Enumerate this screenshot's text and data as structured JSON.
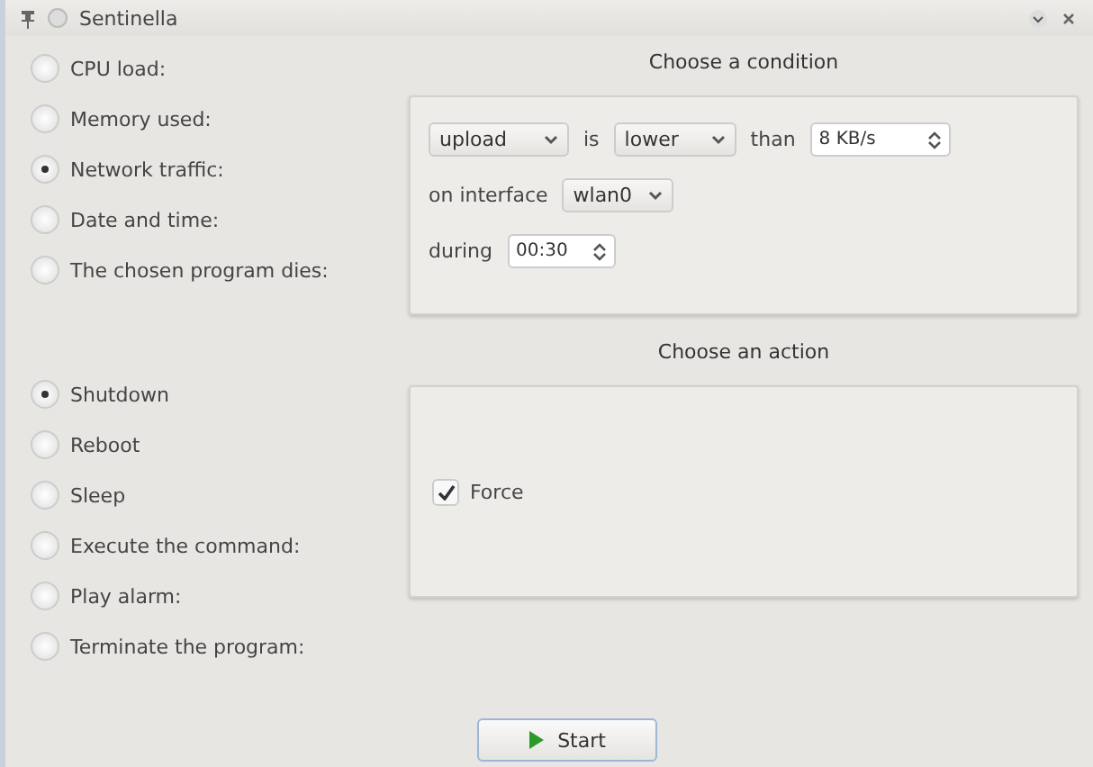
{
  "window": {
    "title": "Sentinella"
  },
  "conditions": [
    {
      "label": "CPU load:",
      "selected": false
    },
    {
      "label": "Memory used:",
      "selected": false
    },
    {
      "label": "Network traffic:",
      "selected": true
    },
    {
      "label": "Date and time:",
      "selected": false
    },
    {
      "label": "The chosen program dies:",
      "selected": false
    }
  ],
  "condition_panel": {
    "title": "Choose a condition",
    "direction": "upload",
    "is_label": "is",
    "comparison": "lower",
    "than_label": "than",
    "threshold": "8 KB/s",
    "interface_label": "on interface",
    "interface": "wlan0",
    "during_label": "during",
    "duration": "00:30"
  },
  "actions": [
    {
      "label": "Shutdown",
      "selected": true
    },
    {
      "label": "Reboot",
      "selected": false
    },
    {
      "label": "Sleep",
      "selected": false
    },
    {
      "label": "Execute the command:",
      "selected": false
    },
    {
      "label": "Play alarm:",
      "selected": false
    },
    {
      "label": "Terminate the program:",
      "selected": false
    }
  ],
  "action_panel": {
    "title": "Choose an action",
    "force": {
      "label": "Force",
      "checked": true
    }
  },
  "start_button": {
    "label": "Start"
  }
}
